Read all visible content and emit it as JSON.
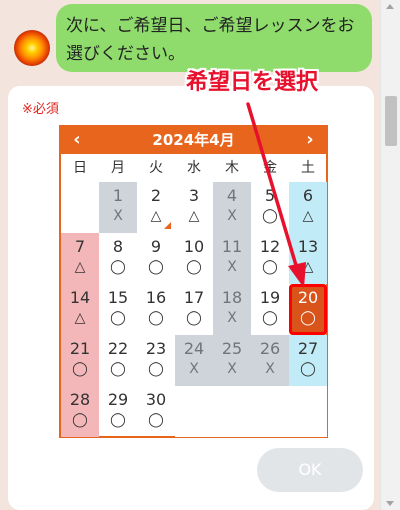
{
  "chat": {
    "message": "次に、ご希望日、ご希望レッスンをお選びください。"
  },
  "form": {
    "required_label": "※必須",
    "ok_label": "OK"
  },
  "calendar": {
    "title": "2024年4月",
    "weekdays": [
      "日",
      "月",
      "火",
      "水",
      "木",
      "金",
      "土"
    ],
    "weeks": [
      [
        {
          "day": "",
          "avail": "",
          "type": "blank"
        },
        {
          "day": "1",
          "avail": "X",
          "type": "closed"
        },
        {
          "day": "2",
          "avail": "△",
          "type": "normal",
          "marker": true
        },
        {
          "day": "3",
          "avail": "△",
          "type": "normal"
        },
        {
          "day": "4",
          "avail": "X",
          "type": "closed"
        },
        {
          "day": "5",
          "avail": "◯",
          "type": "normal"
        },
        {
          "day": "6",
          "avail": "△",
          "type": "sat"
        }
      ],
      [
        {
          "day": "7",
          "avail": "△",
          "type": "sun"
        },
        {
          "day": "8",
          "avail": "◯",
          "type": "normal"
        },
        {
          "day": "9",
          "avail": "◯",
          "type": "normal"
        },
        {
          "day": "10",
          "avail": "◯",
          "type": "normal"
        },
        {
          "day": "11",
          "avail": "X",
          "type": "closed"
        },
        {
          "day": "12",
          "avail": "◯",
          "type": "normal"
        },
        {
          "day": "13",
          "avail": "△",
          "type": "sat"
        }
      ],
      [
        {
          "day": "14",
          "avail": "△",
          "type": "sun"
        },
        {
          "day": "15",
          "avail": "◯",
          "type": "normal"
        },
        {
          "day": "16",
          "avail": "◯",
          "type": "normal"
        },
        {
          "day": "17",
          "avail": "◯",
          "type": "normal"
        },
        {
          "day": "18",
          "avail": "X",
          "type": "closed"
        },
        {
          "day": "19",
          "avail": "◯",
          "type": "normal"
        },
        {
          "day": "20",
          "avail": "◯",
          "type": "sel"
        }
      ],
      [
        {
          "day": "21",
          "avail": "◯",
          "type": "sun"
        },
        {
          "day": "22",
          "avail": "◯",
          "type": "normal"
        },
        {
          "day": "23",
          "avail": "◯",
          "type": "normal"
        },
        {
          "day": "24",
          "avail": "X",
          "type": "closed"
        },
        {
          "day": "25",
          "avail": "X",
          "type": "closed"
        },
        {
          "day": "26",
          "avail": "X",
          "type": "closed"
        },
        {
          "day": "27",
          "avail": "◯",
          "type": "sat"
        }
      ],
      [
        {
          "day": "28",
          "avail": "◯",
          "type": "sun"
        },
        {
          "day": "29",
          "avail": "◯",
          "type": "normal"
        },
        {
          "day": "30",
          "avail": "◯",
          "type": "normal"
        },
        {
          "day": "",
          "avail": "",
          "type": "blank"
        },
        {
          "day": "",
          "avail": "",
          "type": "blank"
        },
        {
          "day": "",
          "avail": "",
          "type": "blank"
        },
        {
          "day": "",
          "avail": "",
          "type": "blank"
        }
      ]
    ]
  },
  "annotation": {
    "text": "希望日を選択"
  },
  "icons": {
    "prev": "chevron-left-icon",
    "next": "chevron-right-icon",
    "avatar": "sun-avatar"
  },
  "colors": {
    "accent": "#e8651d",
    "bubble": "#8fdc6d",
    "sunday": "#f4b7b9",
    "saturday": "#c2ebf8",
    "closed": "#ced4da",
    "selected": "#d9541a",
    "annotation": "#e8112d"
  }
}
